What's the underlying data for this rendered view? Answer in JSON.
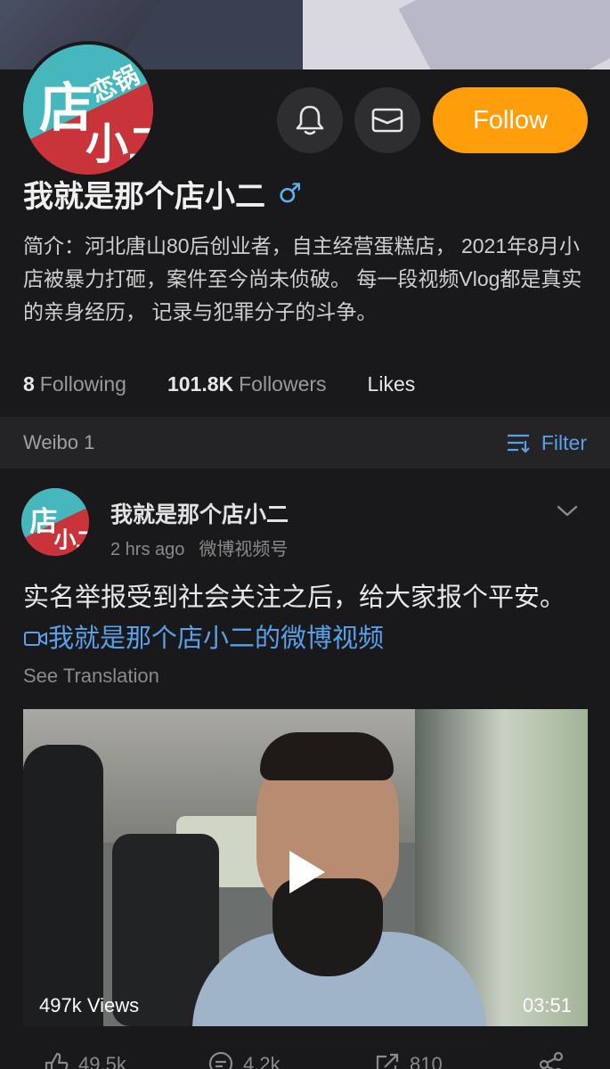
{
  "profile": {
    "name": "我就是那个店小二",
    "gender_symbol": "♂",
    "bio": "简介：河北唐山80后创业者，自主经营蛋糕店， 2021年8月小店被暴力打砸，案件至今尚未侦破。 每一段视频Vlog都是真实的亲身经历， 记录与犯罪分子的斗争。",
    "follow_label": "Follow",
    "stats": {
      "following_count": "8",
      "following_label": "Following",
      "followers_count": "101.8K",
      "followers_label": "Followers",
      "likes_label": "Likes"
    }
  },
  "tabbar": {
    "weibo_label": "Weibo 1",
    "filter_label": "Filter"
  },
  "post": {
    "author": "我就是那个店小二",
    "time": "2 hrs ago",
    "source": "微博视频号",
    "text": "实名举报受到社会关注之后，给大家报个平安。",
    "link": "我就是那个店小二的微博视频",
    "see_translation": "See Translation",
    "video": {
      "views": "497k Views",
      "duration": "03:51"
    },
    "actions": {
      "likes": "49.5k",
      "comments": "4.2k",
      "reposts": "810"
    }
  },
  "colors": {
    "accent": "#ff9d0a",
    "link": "#5aa0e8",
    "background": "#19191b"
  },
  "icons": [
    "bell-icon",
    "mail-icon",
    "male-icon",
    "filter-icon",
    "chevron-down-icon",
    "play-icon",
    "video-link-icon",
    "like-icon",
    "comment-icon",
    "repost-icon",
    "share-icon"
  ]
}
